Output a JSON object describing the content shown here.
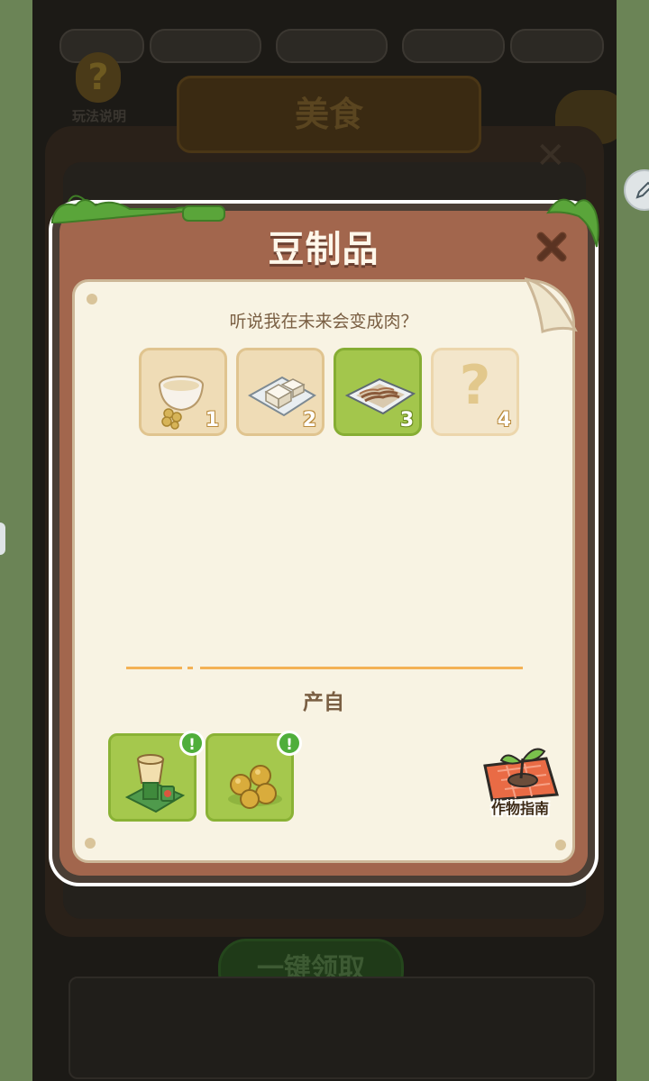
{
  "background": {
    "help_label": "玩法说明",
    "title": "美食",
    "claim_all_button": "一键领取"
  },
  "popup": {
    "title": "豆制品",
    "subtitle": "听说我在未来会变成肉？",
    "stages": [
      {
        "num": "1",
        "icon": "soy-milk-bowl-icon",
        "state": "unlocked"
      },
      {
        "num": "2",
        "icon": "tofu-plate-icon",
        "state": "unlocked"
      },
      {
        "num": "3",
        "icon": "tofu-skin-tray-icon",
        "state": "selected"
      },
      {
        "num": "4",
        "icon": "question-mark-icon",
        "state": "locked",
        "symbol": "?"
      }
    ],
    "source_label": "产自",
    "sources": [
      {
        "icon": "grinding-machine-icon",
        "alert": "!"
      },
      {
        "icon": "soybeans-icon",
        "alert": "!"
      }
    ],
    "guide_label": "作物指南"
  },
  "colors": {
    "wood": "#a2664d",
    "paper": "#f8f3e3",
    "selected_green": "#a3c64c",
    "accent_orange": "#f3b155"
  }
}
